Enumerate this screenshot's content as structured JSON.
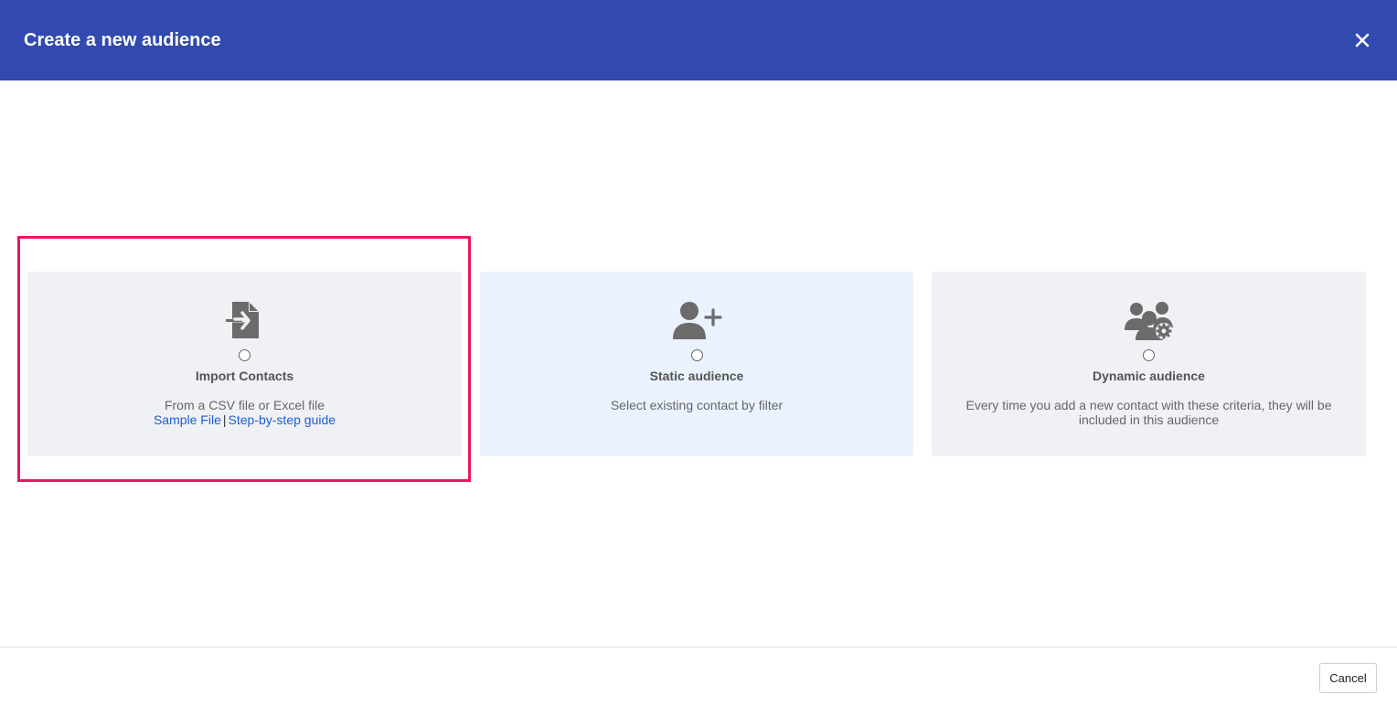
{
  "header": {
    "title": "Create a new audience",
    "close_icon": "close-icon",
    "background_color": "#3249b0"
  },
  "options": [
    {
      "title": "Import Contacts",
      "description": "From a CSV file or Excel file",
      "icon": "file-import-icon",
      "selected": false,
      "links": [
        {
          "label": "Sample File"
        },
        {
          "label": "Step-by-step guide"
        }
      ],
      "link_separator": "|"
    },
    {
      "title": "Static audience",
      "description": "Select existing contact by filter",
      "icon": "user-plus-icon",
      "selected": false
    },
    {
      "title": "Dynamic audience",
      "description": "Every time you add a new contact with these criteria, they will be included in this audience",
      "icon": "users-gear-icon",
      "selected": false
    }
  ],
  "footer": {
    "cancel_label": "Cancel"
  },
  "colors": {
    "highlight_border": "#e8175d",
    "link": "#1a5fd4",
    "card_bg": "#f0f1f5",
    "card_hover_bg": "#eaf2fd"
  }
}
